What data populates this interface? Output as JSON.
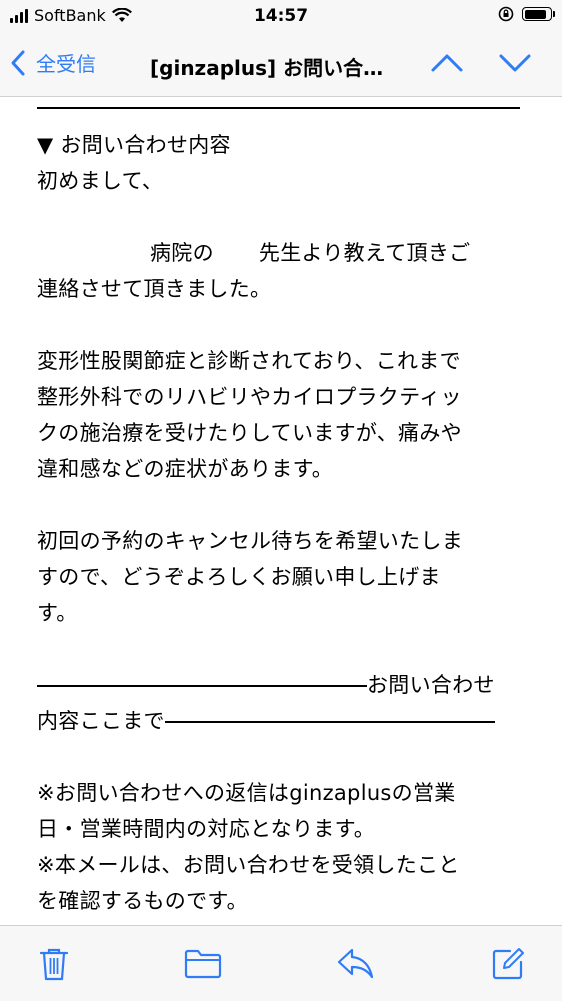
{
  "status_bar": {
    "carrier": "SoftBank",
    "time": "14:57"
  },
  "nav": {
    "back_label": "全受信",
    "title": "[ginzaplus] お問い合…"
  },
  "message": {
    "section_header": "▼ お問い合わせ内容",
    "greeting": "初めまして、",
    "line_hospital_a": "病院の",
    "line_hospital_b": "先生より教えて頂きご",
    "line_contact": "連絡させて頂きました。",
    "para2": [
      "変形性股関節症と診断されており、これまで",
      "整形外科でのリハビリやカイロプラクティッ",
      "クの施治療を受けたりしていますが、痛みや",
      "違和感などの症状があります。"
    ],
    "para3": [
      "初回の予約のキャンセル待ちを希望いたしま",
      "すので、どうぞよろしくお願い申し上げま",
      "す。"
    ],
    "end_marker_a": "お問い合わせ",
    "end_marker_b": "内容ここまで",
    "note1": [
      "※お問い合わせへの返信はginzaplusの営業",
      "日・営業時間内の対応となります。"
    ],
    "note2": [
      "※本メールは、お問い合わせを受領したこと",
      "を確認するものです。"
    ]
  },
  "toolbar": {
    "icons": [
      "trash-icon",
      "folder-icon",
      "reply-icon",
      "compose-icon"
    ]
  },
  "colors": {
    "accent": "#2f7cf6",
    "bar_bg": "#f7f7f7"
  }
}
